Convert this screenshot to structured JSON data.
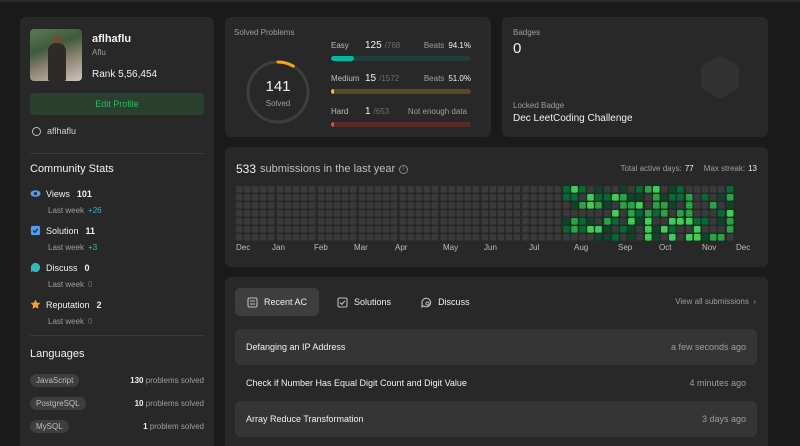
{
  "profile": {
    "username": "aflhaflu",
    "real_name": "Aflu",
    "rank_label": "Rank",
    "rank_value": "5,56,454",
    "edit_button": "Edit Profile",
    "github": "aflhaflu"
  },
  "community": {
    "title": "Community Stats",
    "items": [
      {
        "label": "Views",
        "value": "101",
        "sub": "Last week",
        "delta": "+26",
        "icon": "eye-icon",
        "color": "#4b9ef6"
      },
      {
        "label": "Solution",
        "value": "11",
        "sub": "Last week",
        "delta": "+3",
        "icon": "solution-icon",
        "color": "#4b9ef6"
      },
      {
        "label": "Discuss",
        "value": "0",
        "sub": "Last week",
        "delta": "0",
        "icon": "discuss-icon",
        "color": "#2cbbbb"
      },
      {
        "label": "Reputation",
        "value": "2",
        "sub": "Last week",
        "delta": "0",
        "icon": "reputation-icon",
        "color": "#ffa116"
      }
    ]
  },
  "languages": {
    "title": "Languages",
    "items": [
      {
        "name": "JavaScript",
        "count": "130",
        "suffix": "problems solved"
      },
      {
        "name": "PostgreSQL",
        "count": "10",
        "suffix": "problems solved"
      },
      {
        "name": "MySQL",
        "count": "1",
        "suffix": "problem solved"
      }
    ]
  },
  "solved": {
    "label": "Solved Problems",
    "total": "141",
    "total_label": "Solved",
    "difficulties": [
      {
        "name": "Easy",
        "count": "125",
        "total": "/768",
        "beats_label": "Beats",
        "beats": "94.1%",
        "fraction": 0.163,
        "color": "#00b8a3",
        "track": "#1f3f3b"
      },
      {
        "name": "Medium",
        "count": "15",
        "total": "/1572",
        "beats_label": "Beats",
        "beats": "51.0%",
        "fraction": 0.01,
        "color": "#ffc01e",
        "track": "#5a4a1f"
      },
      {
        "name": "Hard",
        "count": "1",
        "total": "/653",
        "beats_label": "Not enough data",
        "beats": "",
        "fraction": 0.002,
        "color": "#ef4743",
        "track": "#5a2a28"
      }
    ]
  },
  "badges": {
    "label": "Badges",
    "count": "0",
    "locked_label": "Locked Badge",
    "locked_name": "Dec LeetCoding Challenge"
  },
  "submissions": {
    "count": "533",
    "text": "submissions in the last year",
    "active_days_label": "Total active days:",
    "active_days": "77",
    "max_streak_label": "Max streak:",
    "max_streak": "13",
    "months": [
      "Dec",
      "Jan",
      "Feb",
      "Mar",
      "Apr",
      "May",
      "Jun",
      "Jul",
      "Aug",
      "Sep",
      "Oct",
      "Nov",
      "Dec"
    ],
    "colors": {
      "empty": "#3a3a3a",
      "low": "#0e4429",
      "mid": "#006d32",
      "high": "#26a641",
      "max": "#39d353"
    }
  },
  "recent": {
    "tabs": [
      {
        "label": "Recent AC",
        "icon": "list-icon",
        "active": true
      },
      {
        "label": "Solutions",
        "icon": "solutions-icon",
        "active": false
      },
      {
        "label": "Discuss",
        "icon": "discuss-search-icon",
        "active": false
      }
    ],
    "view_all": "View all submissions",
    "rows": [
      {
        "title": "Defanging an IP Address",
        "time": "a few seconds ago"
      },
      {
        "title": "Check if Number Has Equal Digit Count and Digit Value",
        "time": "4 minutes ago"
      },
      {
        "title": "Array Reduce Transformation",
        "time": "3 days ago"
      }
    ]
  }
}
